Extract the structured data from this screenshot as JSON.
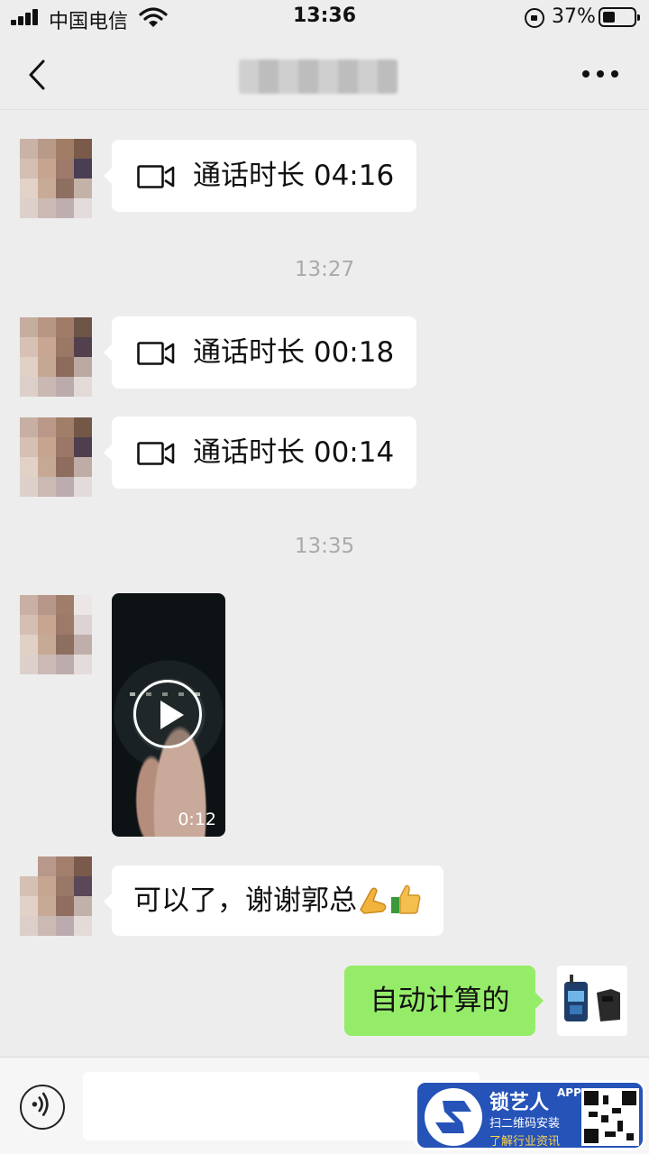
{
  "status_bar": {
    "carrier": "中国电信",
    "time": "13:36",
    "battery_percent": "37%",
    "battery_level": 0.37
  },
  "header": {
    "title": "",
    "back_icon": "chevron-left-icon",
    "more_icon": "more-dots-icon"
  },
  "messages": [
    {
      "type": "call",
      "direction": "incoming",
      "label": "通话时长 04:16"
    },
    {
      "type": "time",
      "label": "13:27"
    },
    {
      "type": "call",
      "direction": "incoming",
      "label": "通话时长 00:18"
    },
    {
      "type": "call",
      "direction": "incoming",
      "label": "通话时长 00:14"
    },
    {
      "type": "time",
      "label": "13:35"
    },
    {
      "type": "video",
      "direction": "incoming",
      "duration": "0:12"
    },
    {
      "type": "text",
      "direction": "incoming",
      "label": "可以了，谢谢郭总",
      "emojis": [
        "ok-hand-emoji",
        "thumbs-up-emoji"
      ]
    },
    {
      "type": "text",
      "direction": "outgoing",
      "label": "自动计算的"
    }
  ],
  "input_bar": {
    "voice_icon": "voice-icon",
    "placeholder": ""
  },
  "watermark": {
    "title": "锁艺人",
    "badge": "APP",
    "line1": "扫二维码安装",
    "line2": "了解行业资讯"
  },
  "colors": {
    "background": "#ededed",
    "outgoing_bubble": "#95ec69",
    "incoming_bubble": "#ffffff",
    "watermark_bg": "#2553b8"
  }
}
